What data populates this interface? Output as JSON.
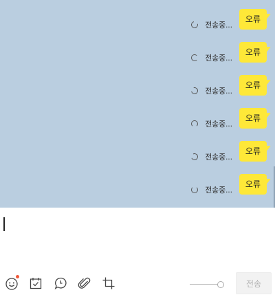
{
  "messages": [
    {
      "status": "전송중...",
      "text": "오류"
    },
    {
      "status": "전송중...",
      "text": "오류"
    },
    {
      "status": "전송중...",
      "text": "오류"
    },
    {
      "status": "전송중...",
      "text": "오류"
    },
    {
      "status": "전송중...",
      "text": "오류"
    },
    {
      "status": "전송중...",
      "text": "오류"
    }
  ],
  "input": {
    "value": ""
  },
  "toolbar": {
    "icons": [
      "emoji-icon",
      "calendar-check-icon",
      "speech-bubble-icon",
      "paperclip-icon",
      "crop-icon"
    ],
    "send_label": "전송"
  },
  "colors": {
    "chat_background": "#bacee0",
    "bubble": "#fee838",
    "notification_dot": "#f05a3c"
  }
}
